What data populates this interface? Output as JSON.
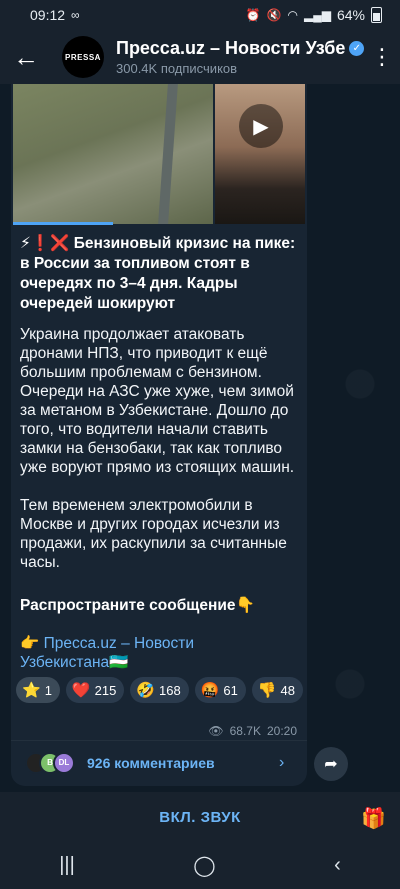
{
  "status": {
    "time": "09:12",
    "battery": "64%"
  },
  "header": {
    "title": "Пресса.uz – Новости Узбе",
    "avatar_text": "PRESSA",
    "subscribers": "300.4K подписчиков"
  },
  "post": {
    "title": "⚡❗❌ Бензиновый кризис на пике: в России за топливом стоят в очередях по 3–4 дня. Кадры очередей шокируют",
    "paragraph1": "Украина продолжает атаковать дронами НПЗ, что приводит к ещё большим проблемам с бензином. Очереди на АЗС уже хуже, чем зимой за метаном в Узбекистане. Дошло до того, что водители начали ставить замки на бензобаки, так как топливо уже воруют прямо из стоящих машин.",
    "paragraph2": "Тем временем электромобили в Москве и других городах исчезли из продажи, их раскупили за считанные часы.",
    "share_text": "Распространите сообщение👇",
    "channel_link": "👉 Пресса.uz – Новости Узбекистана🇺🇿",
    "reactions": [
      {
        "emoji": "⭐",
        "count": "1"
      },
      {
        "emoji": "❤️",
        "count": "215"
      },
      {
        "emoji": "🤣",
        "count": "168"
      },
      {
        "emoji": "🤬",
        "count": "61"
      },
      {
        "emoji": "👎",
        "count": "48"
      }
    ],
    "views": "68.7K",
    "time": "20:20",
    "comments_label": "926 комментариев",
    "comment_avatars": [
      "",
      "B",
      "DL"
    ]
  },
  "bottom": {
    "unmute_label": "ВКЛ. ЗВУК"
  }
}
